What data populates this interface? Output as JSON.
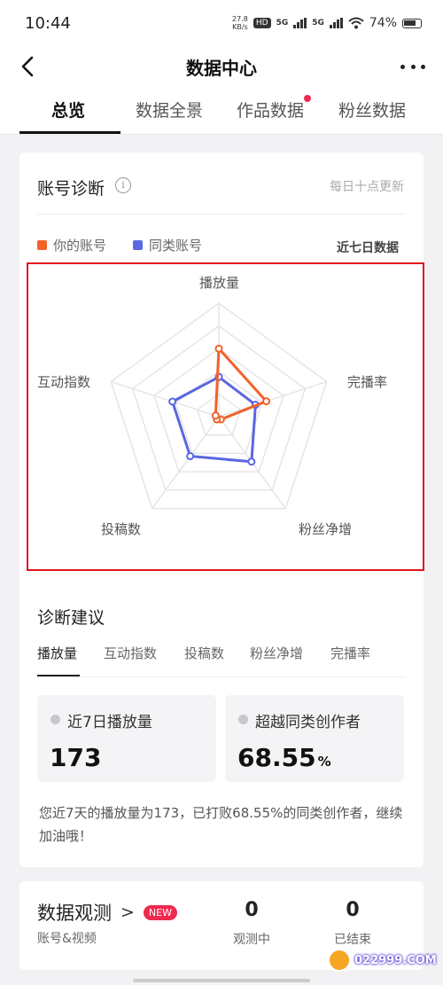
{
  "status_bar": {
    "time": "10:44",
    "net_speed": "27.8",
    "net_unit": "KB/s",
    "hd": "HD",
    "signal_1": "5G",
    "signal_2": "5G",
    "battery": "74%"
  },
  "nav": {
    "title": "数据中心"
  },
  "tabs": [
    "总览",
    "数据全景",
    "作品数据",
    "粉丝数据"
  ],
  "diagnosis": {
    "title": "账号诊断",
    "info_icon": "i",
    "update_note": "每日十点更新",
    "legend": [
      {
        "label": "你的账号",
        "color": "#f0622a"
      },
      {
        "label": "同类账号",
        "color": "#5b67e0"
      }
    ],
    "period": "近七日数据",
    "axes": [
      "播放量",
      "完播率",
      "粉丝净增",
      "投稿数",
      "互动指数"
    ]
  },
  "chart_data": {
    "type": "radar",
    "max": 5,
    "rings": 5,
    "axes": [
      "播放量",
      "完播率",
      "粉丝净增",
      "投稿数",
      "互动指数"
    ],
    "series": [
      {
        "name": "你的账号",
        "color": "#f0622a",
        "values": [
          3.0,
          2.2,
          0.15,
          0.15,
          0.15
        ]
      },
      {
        "name": "同类账号",
        "color": "#5b67e0",
        "values": [
          1.75,
          1.7,
          2.45,
          2.15,
          2.15
        ]
      }
    ]
  },
  "suggestion": {
    "title": "诊断建议",
    "tabs": [
      "播放量",
      "互动指数",
      "投稿数",
      "粉丝净增",
      "完播率"
    ],
    "stat_1": {
      "label": "近7日播放量",
      "value": "173"
    },
    "stat_2": {
      "label": "超越同类创作者",
      "value": "68.55",
      "unit": "%"
    },
    "summary": "您近7天的播放量为173，已打败68.55%的同类创作者，继续加油哦！"
  },
  "observation": {
    "title": "数据观测",
    "chevron": ">",
    "badge": "NEW",
    "subtitle": "账号&视频",
    "watching_count": "0",
    "watching_label": "观测中",
    "ended_count": "0",
    "ended_label": "已结束"
  },
  "watermark": {
    "text": "022999.COM"
  }
}
